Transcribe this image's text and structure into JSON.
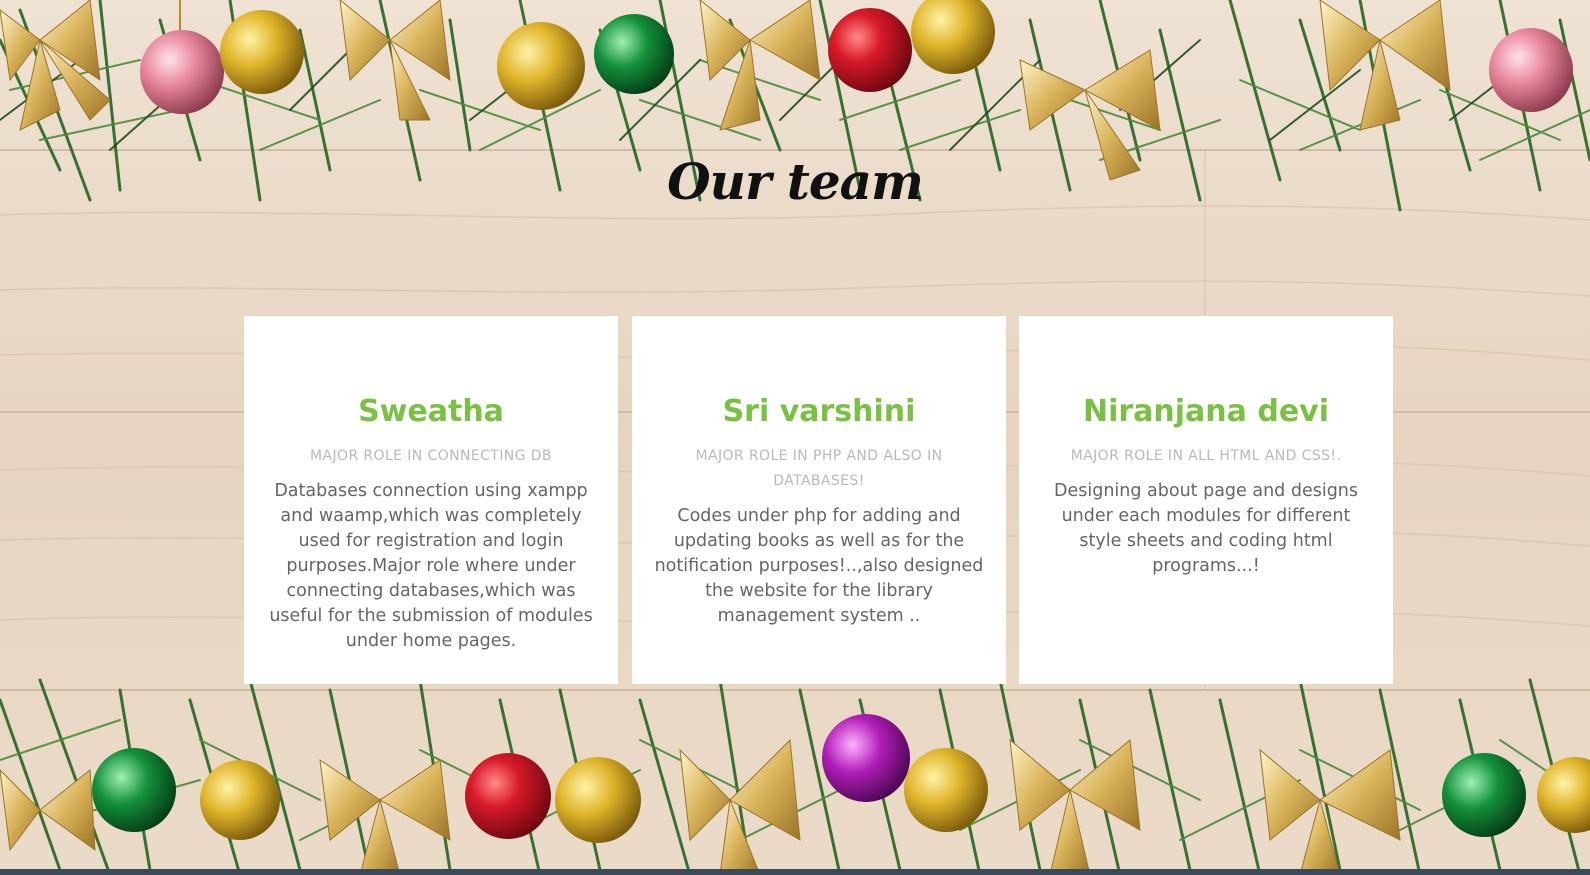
{
  "page": {
    "title": "Our team"
  },
  "team": [
    {
      "name": "Sweatha",
      "role": "MAJOR ROLE IN CONNECTING DB",
      "description": "Databases connection using xampp and waamp,which was completely used for registration and login purposes.Major role where under connecting databases,which was useful for the submission of modules under home pages."
    },
    {
      "name": "Sri varshini",
      "role": "MAJOR ROLE IN PHP AND ALSO IN DATABASES!",
      "description": "Codes under php for adding and updating books as well as for the notification purposes!..,also designed the website for the library management system .."
    },
    {
      "name": "Niranjana devi",
      "role": "MAJOR ROLE IN ALL HTML AND CSS!.",
      "description": "Designing about page and designs under each modules for different style sheets and coding html programs...!"
    }
  ],
  "colors": {
    "name_accent": "#7ac143",
    "role_text": "#b9b9b9",
    "desc_text": "#666666",
    "card_bg": "#ffffff",
    "wood": "#e9d9c6",
    "pine": "#2f6b2a"
  }
}
